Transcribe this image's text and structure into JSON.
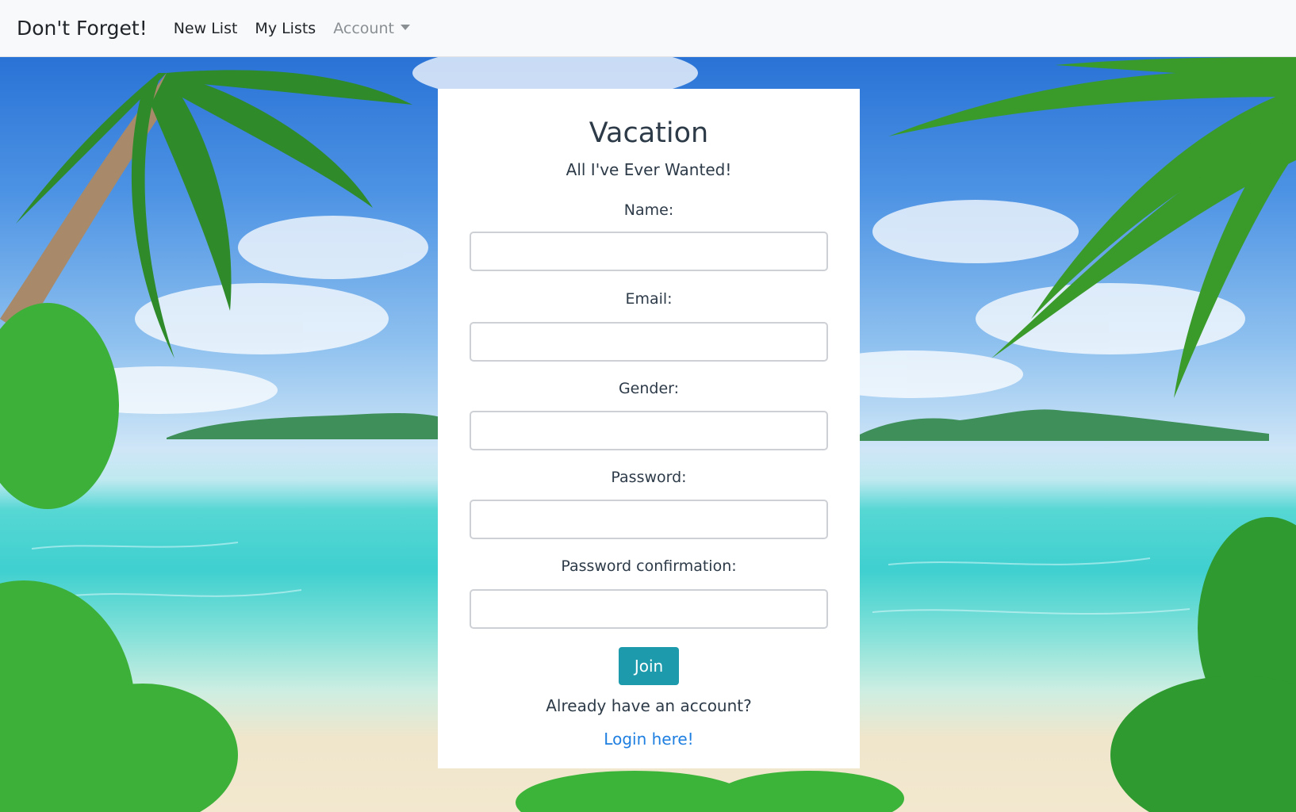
{
  "navbar": {
    "brand": "Don't Forget!",
    "links": [
      "New List",
      "My Lists"
    ],
    "account_label": "Account"
  },
  "card": {
    "title": "Vacation",
    "subtitle": "All I've Ever Wanted!",
    "fields": {
      "name_label": "Name:",
      "email_label": "Email:",
      "gender_label": "Gender:",
      "password_label": "Password:",
      "password_confirmation_label": "Password confirmation:"
    },
    "join_label": "Join",
    "already_text": "Already have an account?",
    "login_link": "Login here!"
  },
  "colors": {
    "navbar_bg": "#f8f9fa",
    "join_button": "#1d9aab",
    "link": "#1f7fe0"
  }
}
